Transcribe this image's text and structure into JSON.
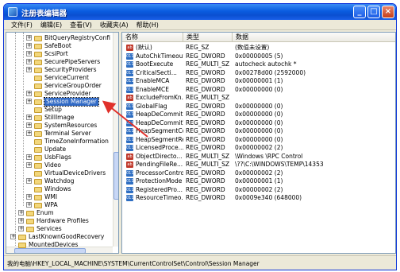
{
  "window": {
    "title": "注册表编辑器"
  },
  "titlebar_buttons": {
    "minimize": "_",
    "maximize": "□",
    "close": "×"
  },
  "menu": [
    "文件(F)",
    "编辑(E)",
    "查看(V)",
    "收藏夹(A)",
    "帮助(H)"
  ],
  "tree": {
    "items": [
      {
        "label": "BitQueryRegistryConfi",
        "expander": "+"
      },
      {
        "label": "SafeBoot",
        "expander": "+"
      },
      {
        "label": "ScsiPort",
        "expander": "+"
      },
      {
        "label": "SecurePipeServers",
        "expander": "+"
      },
      {
        "label": "SecurityProviders",
        "expander": "+"
      },
      {
        "label": "ServiceCurrent",
        "expander": ""
      },
      {
        "label": "ServiceGroupOrder",
        "expander": ""
      },
      {
        "label": "ServiceProvider",
        "expander": "+"
      },
      {
        "label": "Session Manager",
        "expander": "+",
        "selected": true
      },
      {
        "label": "Setup",
        "expander": ""
      },
      {
        "label": "StillImage",
        "expander": "+"
      },
      {
        "label": "SystemResources",
        "expander": "+"
      },
      {
        "label": "Terminal Server",
        "expander": "+"
      },
      {
        "label": "TimeZoneInformation",
        "expander": ""
      },
      {
        "label": "Update",
        "expander": ""
      },
      {
        "label": "UsbFlags",
        "expander": "+"
      },
      {
        "label": "Video",
        "expander": "+"
      },
      {
        "label": "VirtualDeviceDrivers",
        "expander": ""
      },
      {
        "label": "Watchdog",
        "expander": "+"
      },
      {
        "label": "Windows",
        "expander": ""
      },
      {
        "label": "WMI",
        "expander": "+"
      },
      {
        "label": "WPA",
        "expander": "+"
      },
      {
        "label": "Enum",
        "expander": "+"
      },
      {
        "label": "Hardware Profiles",
        "expander": "+"
      },
      {
        "label": "Services",
        "expander": "+"
      },
      {
        "label": "LastKnownGoodRecovery",
        "expander": "+"
      },
      {
        "label": "MountedDevices",
        "expander": ""
      }
    ]
  },
  "list": {
    "columns": [
      "名称",
      "类型",
      "数据"
    ],
    "rows": [
      {
        "icon": "ab",
        "name": "(默认)",
        "type": "REG_SZ",
        "data": "(数值未设置)"
      },
      {
        "icon": "bin",
        "name": "AutoChkTimeout",
        "type": "REG_DWORD",
        "data": "0x00000005 (5)"
      },
      {
        "icon": "bin",
        "name": "BootExecute",
        "type": "REG_MULTI_SZ",
        "data": "autocheck autochk *"
      },
      {
        "icon": "bin",
        "name": "CriticalSecti...",
        "type": "REG_DWORD",
        "data": "0x00278d00 (2592000)"
      },
      {
        "icon": "bin",
        "name": "EnableMCA",
        "type": "REG_DWORD",
        "data": "0x00000001 (1)"
      },
      {
        "icon": "bin",
        "name": "EnableMCE",
        "type": "REG_DWORD",
        "data": "0x00000000 (0)"
      },
      {
        "icon": "ab",
        "name": "ExcludeFromKn...",
        "type": "REG_MULTI_SZ",
        "data": ""
      },
      {
        "icon": "bin",
        "name": "GlobalFlag",
        "type": "REG_DWORD",
        "data": "0x00000000 (0)"
      },
      {
        "icon": "bin",
        "name": "HeapDeCommitF...",
        "type": "REG_DWORD",
        "data": "0x00000000 (0)"
      },
      {
        "icon": "bin",
        "name": "HeapDeCommitT...",
        "type": "REG_DWORD",
        "data": "0x00000000 (0)"
      },
      {
        "icon": "bin",
        "name": "HeapSegmentCo...",
        "type": "REG_DWORD",
        "data": "0x00000000 (0)"
      },
      {
        "icon": "bin",
        "name": "HeapSegmentRe...",
        "type": "REG_DWORD",
        "data": "0x00000000 (0)"
      },
      {
        "icon": "bin",
        "name": "LicensedProce...",
        "type": "REG_DWORD",
        "data": "0x00000002 (2)"
      },
      {
        "icon": "ab",
        "name": "ObjectDirecto...",
        "type": "REG_MULTI_SZ",
        "data": "\\Windows \\RPC Control"
      },
      {
        "icon": "ab",
        "name": "PendingFileRe...",
        "type": "REG_MULTI_SZ",
        "data": "\\??\\C:\\WINDOWS\\TEMP\\14353"
      },
      {
        "icon": "bin",
        "name": "ProcessorControl",
        "type": "REG_DWORD",
        "data": "0x00000002 (2)"
      },
      {
        "icon": "bin",
        "name": "ProtectionMode",
        "type": "REG_DWORD",
        "data": "0x00000001 (1)"
      },
      {
        "icon": "bin",
        "name": "RegisteredPro...",
        "type": "REG_DWORD",
        "data": "0x00000002 (2)"
      },
      {
        "icon": "bin",
        "name": "ResourceTimeo...",
        "type": "REG_DWORD",
        "data": "0x0009e340 (648000)"
      }
    ]
  },
  "icons": {
    "string": "ab",
    "binary": "011"
  },
  "status": {
    "path": "我的电脑\\HKEY_LOCAL_MACHINE\\SYSTEM\\CurrentControlSet\\Control\\Session Manager"
  },
  "colors": {
    "titlebar": "#0a5ce0",
    "selection": "#316ac5",
    "annotation_arrow": "#e0302a"
  }
}
